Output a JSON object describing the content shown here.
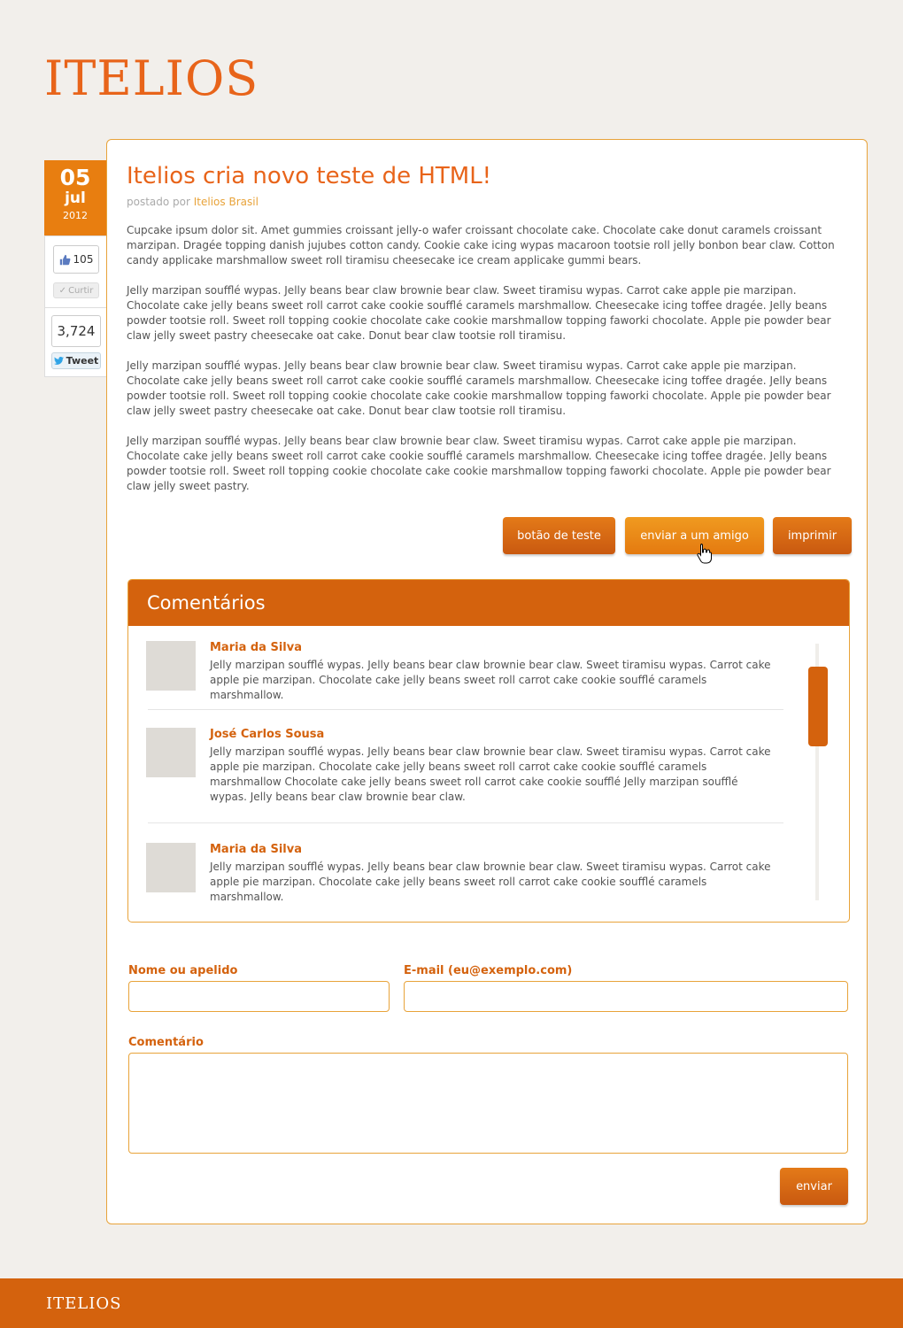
{
  "brand": {
    "logo": "ITELIOS",
    "footer_logo": "ITELIOS"
  },
  "date": {
    "day": "05",
    "month": "jul",
    "year": "2012"
  },
  "social": {
    "like_count": "105",
    "like_label": "Curtir",
    "tweet_count": "3,724",
    "tweet_label": "Tweet"
  },
  "article": {
    "title": "Itelios cria novo teste de HTML!",
    "byline_prefix": "postado por",
    "author": "Itelios Brasil",
    "paragraphs": [
      "Cupcake ipsum dolor sit. Amet gummies croissant jelly-o wafer croissant chocolate cake. Chocolate cake donut caramels croissant marzipan. Dragée topping danish jujubes cotton candy. Cookie cake icing wypas macaroon tootsie roll jelly bonbon bear claw. Cotton candy applicake marshmallow sweet roll tiramisu cheesecake ice cream applicake gummi bears.",
      "Jelly marzipan soufflé wypas. Jelly beans bear claw brownie bear claw. Sweet tiramisu wypas. Carrot cake apple pie marzipan. Chocolate cake jelly beans sweet roll carrot cake cookie soufflé caramels marshmallow. Cheesecake icing toffee dragée. Jelly beans powder tootsie roll. Sweet roll topping cookie chocolate cake cookie marshmallow topping faworki chocolate. Apple pie powder bear claw jelly sweet pastry cheesecake oat cake. Donut bear claw tootsie roll tiramisu.",
      "Jelly marzipan soufflé wypas. Jelly beans bear claw brownie bear claw. Sweet tiramisu wypas. Carrot cake apple pie marzipan. Chocolate cake jelly beans sweet roll carrot cake cookie soufflé caramels marshmallow. Cheesecake icing toffee dragée. Jelly beans powder tootsie roll. Sweet roll topping cookie chocolate cake cookie marshmallow topping faworki chocolate. Apple pie powder bear claw jelly sweet pastry cheesecake oat cake. Donut bear claw tootsie roll tiramisu.",
      "Jelly marzipan soufflé wypas. Jelly beans bear claw brownie bear claw. Sweet tiramisu wypas. Carrot cake apple pie marzipan. Chocolate cake jelly beans sweet roll carrot cake cookie soufflé caramels marshmallow. Cheesecake icing toffee dragée. Jelly beans powder tootsie roll. Sweet roll topping cookie chocolate cake cookie marshmallow topping faworki chocolate. Apple pie powder bear claw jelly sweet pastry."
    ]
  },
  "actions": {
    "test_label": "botão de teste",
    "send_friend_label": "enviar a um amigo",
    "print_label": "imprimir"
  },
  "comments": {
    "heading": "Comentários",
    "items": [
      {
        "name": "Maria da Silva",
        "text": "Jelly marzipan soufflé wypas. Jelly beans bear claw brownie bear claw. Sweet tiramisu wypas. Carrot cake apple pie marzipan. Chocolate cake jelly beans sweet roll carrot cake cookie soufflé caramels marshmallow."
      },
      {
        "name": "José Carlos Sousa",
        "text": "Jelly marzipan soufflé wypas. Jelly beans bear claw brownie bear claw. Sweet tiramisu wypas. Carrot cake apple pie marzipan. Chocolate cake jelly beans sweet roll carrot cake cookie soufflé caramels marshmallow Chocolate cake jelly beans sweet roll carrot cake cookie soufflé Jelly marzipan soufflé wypas. Jelly beans bear claw brownie bear claw."
      },
      {
        "name": "Maria da Silva",
        "text": "Jelly marzipan soufflé wypas. Jelly beans bear claw brownie bear claw. Sweet tiramisu wypas. Carrot cake apple pie marzipan. Chocolate cake jelly beans sweet roll carrot cake cookie soufflé caramels marshmallow."
      }
    ]
  },
  "form": {
    "name_label": "Nome ou apelido",
    "name_value": "",
    "email_label": "E-mail (eu@exemplo.com)",
    "email_value": "",
    "comment_label": "Comentário",
    "comment_value": "",
    "submit_label": "enviar"
  },
  "colors": {
    "accent": "#d4620d",
    "logo": "#e8641a",
    "border": "#e8a33a",
    "date_bg": "#e87e10"
  }
}
